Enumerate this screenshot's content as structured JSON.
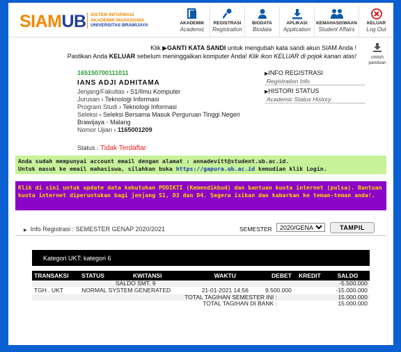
{
  "header": {
    "logo_siam": "SIAM",
    "logo_ub": "UB",
    "logo_sub": [
      "SISTEM INFORMASI",
      "AKADEMIK MAHASISWA",
      "UNIVERSITAS BRAWIJAYA"
    ],
    "nav": [
      {
        "t1": "AKADEMIK",
        "t2": "Academic",
        "icon": "document-icon"
      },
      {
        "t1": "REGISTRASI",
        "t2": "Registration",
        "icon": "key-icon"
      },
      {
        "t1": "BIODATA",
        "t2": "Biodata",
        "icon": "user-icon"
      },
      {
        "t1": "APLIKASI",
        "t2": "Application",
        "icon": "download-icon"
      },
      {
        "t1": "KEMAHASISWAAN",
        "t2": "Student Affairs",
        "icon": "people-icon"
      },
      {
        "t1": "KELUAR",
        "t2": "Log Out",
        "icon": "close-icon"
      }
    ]
  },
  "notice": {
    "l1_pre": "Klik ",
    "l1_bold": "GANTI KATA SANDI",
    "l1_post": " untuk mengubah kata sandi akun SIAM Anda !",
    "l2_pre": "Pastikan Anda ",
    "l2_bold": "KELUAR",
    "l2_mid": " sebelum meninggalkan komputer Anda! ",
    "l2_italic": "Klik ikon KELUAR di pojok kanan atas!"
  },
  "unduh": {
    "label1": "unduh",
    "label2": "panduan"
  },
  "profile": {
    "nim": "165150700111011",
    "name": "IANS ADJI ADHITAMA",
    "jenjang_label": "Jenjang/Fakultas",
    "jenjang_value": "S1/Ilmu Komputer",
    "jurusan_label": "Jurusan",
    "jurusan_value": "Teknologi Informasi",
    "prodi_label": "Program Studi",
    "prodi_value": "Teknologi Informasi",
    "seleksi_label": "Seleksi",
    "seleksi_value": "Seleksi Bersama Masuk Perguruan Tinggi Negeri Brawijaya - Malang",
    "ujian_label": "Nomor Ujian",
    "ujian_value": "1165001209",
    "status_label": "Status :",
    "status_value": "Tidak Terdaftar"
  },
  "side": [
    {
      "t1": "INFO REGISTRASI",
      "t2": "Registration Info"
    },
    {
      "t1": "HISTORI STATUS",
      "t2": "Academic Status History"
    }
  ],
  "email_banner": {
    "l1": "Anda sudah mempunyai account email dengan alamat : annadevitt@student.ub.ac.id.",
    "l2_pre": "Untuk masuk ke email mahasiswa, silahkan buka ",
    "l2_link": "https://gapura.ub.ac.id",
    "l2_post": " kemudian klik Login."
  },
  "pddikti_banner": "Klik di sini untuk update data kebutuhan PDDIKTI (Kemendikbud) dan bantuan kuota internet (pulsa). Bantuan kuota internet diperuntukan bagi jenjang S1, D3 dan D4. Segera isikan dan kabarkan ke teman-teman anda!.",
  "filter": {
    "info_label": "Info Registrasi  :  SEMESTER GENAP 2020/2021",
    "semester_label": "SEMESTER",
    "semester_value": "2020/GENAP",
    "button": "TAMPIL"
  },
  "ukt": {
    "heading": "Kategori UKT: kategori 6",
    "columns": [
      "TRANSAKSI",
      "STATUS",
      "KWITANSI",
      "WAKTU",
      "DEBET",
      "KREDIT",
      "SALDO"
    ],
    "saldo_label": "SALDO SMT. 9",
    "saldo_value": "-5.500.000",
    "row": {
      "transaksi": "TGH . UKT",
      "status": "NORMAL SYSTEM GENERATED",
      "kwitansi": "",
      "waktu": "21-01-2021 14:56",
      "debet": "9.500.000",
      "kredit": "",
      "saldo": "-15.000.000"
    },
    "total_semester_label": "TOTAL TAGIHAN SEMESTER INI :",
    "total_semester_value": "15.000.000",
    "total_bank_label": "TOTAL TAGIHAN DI BANK :",
    "total_bank_value": "15.000.000"
  }
}
